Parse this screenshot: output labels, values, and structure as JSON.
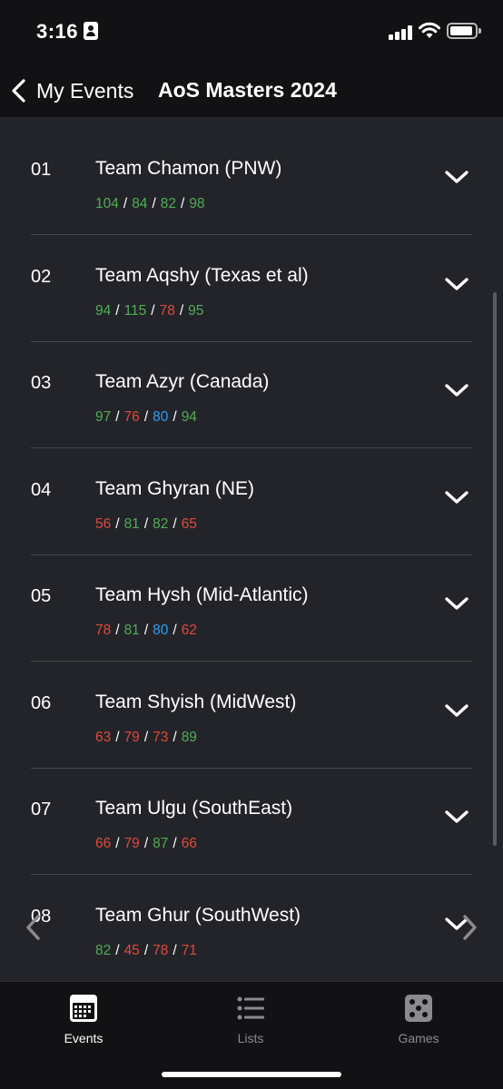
{
  "status_bar": {
    "time": "3:16"
  },
  "nav": {
    "back_label": "My Events",
    "title": "AoS Masters 2024"
  },
  "colors": {
    "green": "#4fae57",
    "red": "#e0493c",
    "blue": "#2e9ff2"
  },
  "teams": [
    {
      "rank": "01",
      "name": "Team Chamon (PNW)",
      "scores": [
        {
          "v": "104",
          "c": "green"
        },
        {
          "v": "84",
          "c": "green"
        },
        {
          "v": "82",
          "c": "green"
        },
        {
          "v": "98",
          "c": "green"
        }
      ]
    },
    {
      "rank": "02",
      "name": "Team Aqshy (Texas et al)",
      "scores": [
        {
          "v": "94",
          "c": "green"
        },
        {
          "v": "115",
          "c": "green"
        },
        {
          "v": "78",
          "c": "red"
        },
        {
          "v": "95",
          "c": "green"
        }
      ]
    },
    {
      "rank": "03",
      "name": "Team Azyr (Canada)",
      "scores": [
        {
          "v": "97",
          "c": "green"
        },
        {
          "v": "76",
          "c": "red"
        },
        {
          "v": "80",
          "c": "blue"
        },
        {
          "v": "94",
          "c": "green"
        }
      ]
    },
    {
      "rank": "04",
      "name": "Team Ghyran (NE)",
      "scores": [
        {
          "v": "56",
          "c": "red"
        },
        {
          "v": "81",
          "c": "green"
        },
        {
          "v": "82",
          "c": "green"
        },
        {
          "v": "65",
          "c": "red"
        }
      ]
    },
    {
      "rank": "05",
      "name": "Team Hysh (Mid-Atlantic)",
      "scores": [
        {
          "v": "78",
          "c": "red"
        },
        {
          "v": "81",
          "c": "green"
        },
        {
          "v": "80",
          "c": "blue"
        },
        {
          "v": "62",
          "c": "red"
        }
      ]
    },
    {
      "rank": "06",
      "name": "Team Shyish (MidWest)",
      "scores": [
        {
          "v": "63",
          "c": "red"
        },
        {
          "v": "79",
          "c": "red"
        },
        {
          "v": "73",
          "c": "red"
        },
        {
          "v": "89",
          "c": "green"
        }
      ]
    },
    {
      "rank": "07",
      "name": "Team Ulgu (SouthEast)",
      "scores": [
        {
          "v": "66",
          "c": "red"
        },
        {
          "v": "79",
          "c": "red"
        },
        {
          "v": "87",
          "c": "green"
        },
        {
          "v": "66",
          "c": "red"
        }
      ]
    },
    {
      "rank": "08",
      "name": "Team Ghur (SouthWest)",
      "scores": [
        {
          "v": "82",
          "c": "green"
        },
        {
          "v": "45",
          "c": "red"
        },
        {
          "v": "78",
          "c": "red"
        },
        {
          "v": "71",
          "c": "red"
        }
      ]
    }
  ],
  "tabs": [
    {
      "label": "Events",
      "icon": "calendar-icon",
      "active": true
    },
    {
      "label": "Lists",
      "icon": "list-icon",
      "active": false
    },
    {
      "label": "Games",
      "icon": "dice-icon",
      "active": false
    }
  ]
}
